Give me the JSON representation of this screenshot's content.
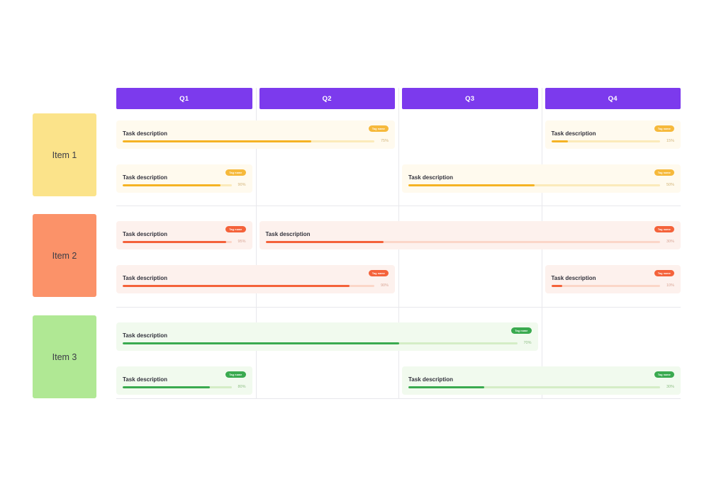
{
  "timeline": {
    "quarters": [
      {
        "label": "Q1"
      },
      {
        "label": "Q2"
      },
      {
        "label": "Q3"
      },
      {
        "label": "Q4"
      }
    ],
    "rows": [
      {
        "label": "Item 1",
        "color": "yellow",
        "swatch": "#fbe38a"
      },
      {
        "label": "Item 2",
        "color": "orange",
        "swatch": "#fb9269"
      },
      {
        "label": "Item 3",
        "color": "green",
        "swatch": "#b0e894"
      }
    ],
    "tasks": [
      {
        "row": 0,
        "lane": 0,
        "start": 0,
        "end": 1,
        "title": "Task description",
        "tag": "Tag name",
        "percent": "75%",
        "value": 75,
        "color": "yellow"
      },
      {
        "row": 0,
        "lane": 0,
        "start": 3,
        "end": 3,
        "title": "Task description",
        "tag": "Tag name",
        "percent": "15%",
        "value": 15,
        "color": "yellow"
      },
      {
        "row": 0,
        "lane": 1,
        "start": 0,
        "end": 0,
        "title": "Task description",
        "tag": "Tag name",
        "percent": "90%",
        "value": 90,
        "color": "yellow"
      },
      {
        "row": 0,
        "lane": 1,
        "start": 2,
        "end": 3,
        "title": "Task description",
        "tag": "Tag name",
        "percent": "50%",
        "value": 50,
        "color": "yellow"
      },
      {
        "row": 1,
        "lane": 0,
        "start": 0,
        "end": 0,
        "title": "Task description",
        "tag": "Tag name",
        "percent": "95%",
        "value": 95,
        "color": "orange"
      },
      {
        "row": 1,
        "lane": 0,
        "start": 1,
        "end": 3,
        "title": "Task description",
        "tag": "Tag name",
        "percent": "30%",
        "value": 30,
        "color": "orange"
      },
      {
        "row": 1,
        "lane": 1,
        "start": 0,
        "end": 1,
        "title": "Task description",
        "tag": "Tag name",
        "percent": "90%",
        "value": 90,
        "color": "orange"
      },
      {
        "row": 1,
        "lane": 1,
        "start": 3,
        "end": 3,
        "title": "Task description",
        "tag": "Tag name",
        "percent": "10%",
        "value": 10,
        "color": "orange"
      },
      {
        "row": 2,
        "lane": 0,
        "start": 0,
        "end": 2,
        "title": "Task description",
        "tag": "Tag name",
        "percent": "70%",
        "value": 70,
        "color": "green"
      },
      {
        "row": 2,
        "lane": 1,
        "start": 0,
        "end": 0,
        "title": "Task description",
        "tag": "Tag name",
        "percent": "80%",
        "value": 80,
        "color": "green"
      },
      {
        "row": 2,
        "lane": 1,
        "start": 2,
        "end": 3,
        "title": "Task description",
        "tag": "Tag name",
        "percent": "30%",
        "value": 30,
        "color": "green"
      }
    ]
  },
  "theme": {
    "header_color": "#7c3aed",
    "background": "#ffffff",
    "grid_line": "#e8e8ec"
  }
}
